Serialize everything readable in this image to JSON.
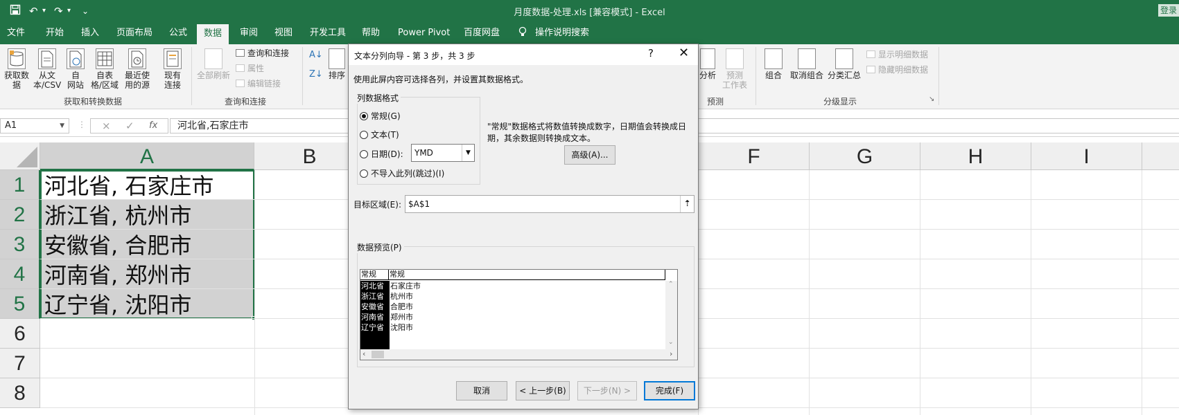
{
  "titlebar": {
    "title": "月度数据-处理.xls  [兼容模式]  -  Excel",
    "login": "登录",
    "save_icon": "save-icon",
    "undo_glyph": "↶",
    "redo_glyph": "↷",
    "customize_glyph": "⌄"
  },
  "tabs": [
    "文件",
    "开始",
    "插入",
    "页面布局",
    "公式",
    "数据",
    "审阅",
    "视图",
    "开发工具",
    "帮助",
    "Power Pivot",
    "百度网盘",
    "操作说明搜索"
  ],
  "active_tab": "数据",
  "ribbon": {
    "get_data": "获取数\n据",
    "from_text": "从文\n本/CSV",
    "from_web": "自\n网站",
    "from_table": "自表\n格/区域",
    "recent": "最近使\n用的源",
    "existing": "现有\n连接",
    "group_get": "获取和转换数据",
    "refresh_all": "全部刷新",
    "queries": "查询和连接",
    "properties": "属性",
    "edit_links": "编辑链接",
    "group_queries": "查询和连接",
    "sort": "排序",
    "analysis": "分析",
    "forecast_sheet": "预测\n工作表",
    "group_forecast": "预测",
    "group": "组合",
    "ungroup": "取消组合",
    "subtotal": "分类汇总",
    "show_detail": "显示明细数据",
    "hide_detail": "隐藏明细数据",
    "group_outline": "分级显示"
  },
  "formula_bar": {
    "namebox": "A1",
    "cancel": "×",
    "enter": "✓",
    "fx": "fx",
    "formula": "河北省,石家庄市"
  },
  "grid": {
    "columns": [
      "A",
      "B",
      "F",
      "G",
      "H",
      "I"
    ],
    "rows": [
      "1",
      "2",
      "3",
      "4",
      "5",
      "6",
      "7",
      "8"
    ],
    "cells_a": [
      "河北省, 石家庄市",
      "浙江省, 杭州市",
      "安徽省, 合肥市",
      "河南省, 郑州市",
      "辽宁省, 沈阳市"
    ]
  },
  "dialog": {
    "title": "文本分列向导 - 第 3 步，共 3 步",
    "help": "?",
    "close": "✕",
    "instruction": "使用此屏内容可选择各列，并设置其数据格式。",
    "format_group": "列数据格式",
    "options": [
      "常规(G)",
      "文本(T)",
      "日期(D):",
      "不导入此列(跳过)(I)"
    ],
    "date_format": "YMD",
    "description_line1": "\"常规\"数据格式将数值转换成数字，日期值会转换成日",
    "description_line2": "期，其余数据则转换成文本。",
    "advanced": "高级(A)...",
    "target_label": "目标区域(E):",
    "target_value": "$A$1",
    "preview_label": "数据预览(P)",
    "preview_headers": [
      "常规",
      "常规"
    ],
    "preview_col1": [
      "河北省",
      "浙江省",
      "安徽省",
      "河南省",
      "辽宁省"
    ],
    "preview_col2": [
      "石家庄市",
      "杭州市",
      "合肥市",
      "郑州市",
      "沈阳市"
    ],
    "buttons": {
      "cancel": "取消",
      "back": "< 上一步(B)",
      "next": "下一步(N) >",
      "finish": "完成(F)"
    }
  }
}
